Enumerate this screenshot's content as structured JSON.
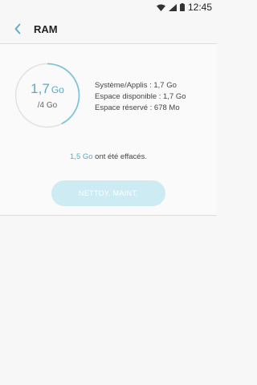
{
  "status_bar": {
    "time": "12:45",
    "icons": [
      "wifi-icon",
      "signal-icon",
      "battery-icon"
    ]
  },
  "app_bar": {
    "back_icon": "chevron-left-icon",
    "title": "RAM"
  },
  "ram_gauge": {
    "used_value": "1,7",
    "used_unit": "Go",
    "total": "/4 Go",
    "used_fraction": 0.425,
    "ring_color": "#7fc6dc",
    "track_color": "#e2e2e2"
  },
  "ram_details": [
    "Système/Applis : 1,7 Go",
    "Espace disponible : 1,7 Go",
    "Espace réservé : 678 Mo"
  ],
  "cleared_message": {
    "amount": "1,5 Go",
    "text": " ont été effacés."
  },
  "clean_button": {
    "label": "NETTOY. MAINT.",
    "color": "#cdebf3"
  },
  "accent_color": "#5aa9c5"
}
